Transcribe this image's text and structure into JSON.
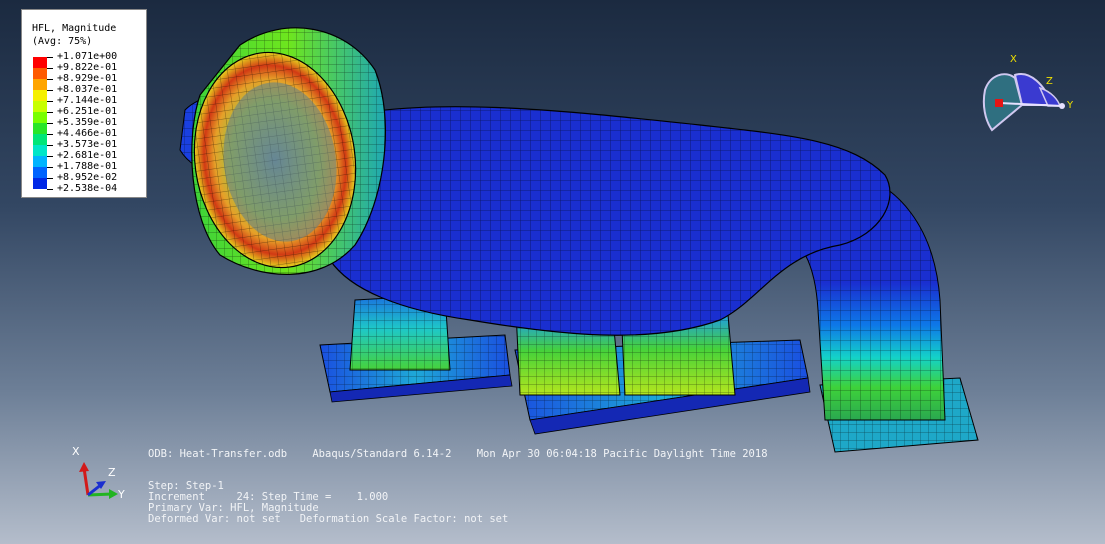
{
  "legend": {
    "title": "HFL, Magnitude",
    "subtitle": "(Avg: 75%)",
    "labels": [
      "+1.071e+00",
      "+9.822e-01",
      "+8.929e-01",
      "+8.037e-01",
      "+7.144e-01",
      "+6.251e-01",
      "+5.359e-01",
      "+4.466e-01",
      "+3.573e-01",
      "+2.681e-01",
      "+1.788e-01",
      "+8.952e-02",
      "+2.538e-04"
    ],
    "colors": [
      "#ff0000",
      "#ff5a00",
      "#ffa500",
      "#f5f000",
      "#c8ff00",
      "#78ff00",
      "#28e628",
      "#00e678",
      "#00e6c8",
      "#00b4ff",
      "#0064ff",
      "#0028e6"
    ]
  },
  "info": {
    "odb": "ODB: Heat-Transfer.odb    Abaqus/Standard 6.14-2    Mon Apr 30 06:04:18 Pacific Daylight Time 2018",
    "step": "Step: Step-1",
    "increment": "Increment     24: Step Time =    1.000",
    "primary": "Primary Var: HFL, Magnitude",
    "deformed": "Deformed Var: not set   Deformation Scale Factor: not set"
  },
  "triad": {
    "x": "X",
    "y": "Y",
    "z": "Z"
  },
  "view_cube": {
    "x": "X",
    "y": "Y",
    "z": "Z"
  },
  "colors": {
    "background_top": "#1b2a40",
    "background_bottom": "#b4bdcb",
    "mesh_blue": "#1a2fd0",
    "mesh_green": "#38d23a",
    "mesh_red": "#d21a0a"
  }
}
